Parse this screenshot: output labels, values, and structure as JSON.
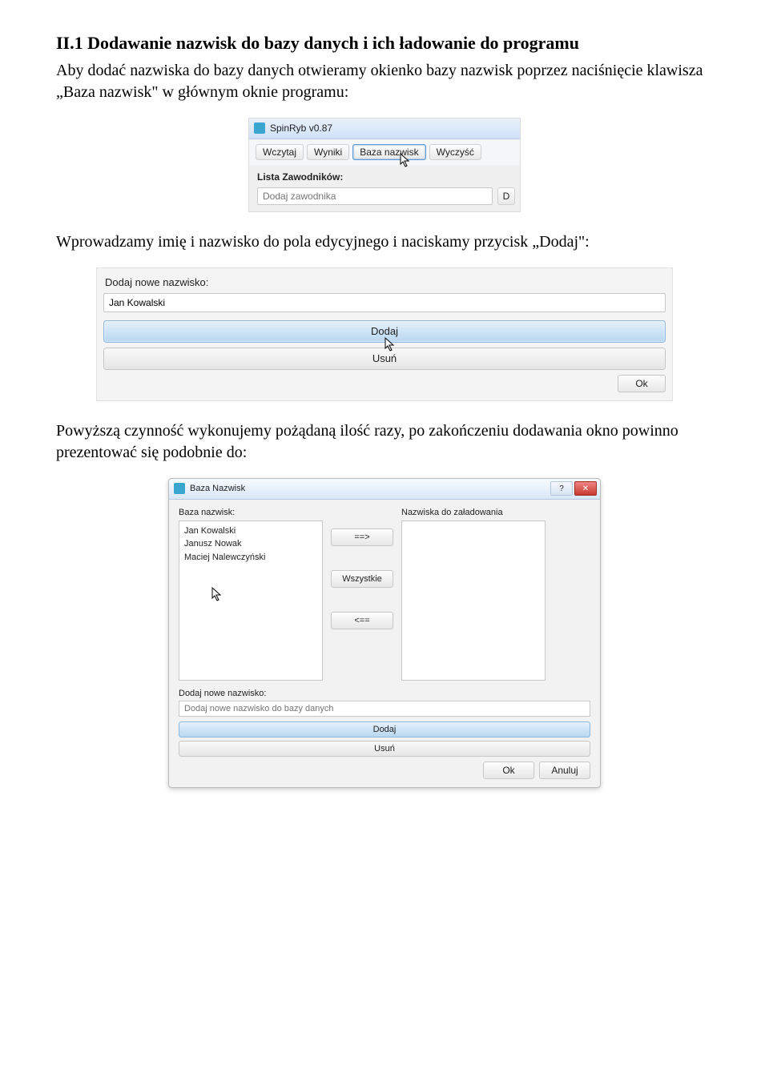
{
  "heading": "II.1 Dodawanie nazwisk do bazy danych i ich ładowanie do programu",
  "para1": "Aby dodać nazwiska do bazy danych otwieramy okienko bazy nazwisk poprzez naciśnięcie klawisza „Baza nazwisk\" w głównym oknie programu:",
  "para2": "Wprowadzamy imię i nazwisko do pola edycyjnego i naciskamy przycisk „Dodaj\":",
  "para3": "Powyższą czynność wykonujemy pożądaną ilość razy, po zakończeniu dodawania okno powinno prezentować się podobnie do:",
  "fig1": {
    "app_title": "SpinRyb v0.87",
    "btn_wczytaj": "Wczytaj",
    "btn_wyniki": "Wyniki",
    "btn_baza": "Baza nazwisk",
    "btn_wyczysc": "Wyczyść",
    "lista_label": "Lista Zawodników:",
    "placeholder": "Dodaj zawodnika",
    "stub_btn": "D"
  },
  "fig2": {
    "label": "Dodaj nowe nazwisko:",
    "value": "Jan Kowalski",
    "btn_add": "Dodaj",
    "btn_remove": "Usuń",
    "btn_ok": "Ok"
  },
  "fig3": {
    "title": "Baza Nazwisk",
    "hdr_left": "Baza nazwisk:",
    "hdr_right": "Nazwiska do załadowania",
    "names": [
      "Jan Kowalski",
      "Janusz Nowak",
      "Maciej Nalewczyński"
    ],
    "btn_right": "==>",
    "btn_all": "Wszystkie",
    "btn_left": "<==",
    "add_label": "Dodaj nowe nazwisko:",
    "add_placeholder": "Dodaj nowe nazwisko do bazy danych",
    "btn_add": "Dodaj",
    "btn_remove": "Usuń",
    "btn_ok": "Ok",
    "btn_cancel": "Anuluj",
    "help_glyph": "?",
    "close_glyph": "✕"
  }
}
